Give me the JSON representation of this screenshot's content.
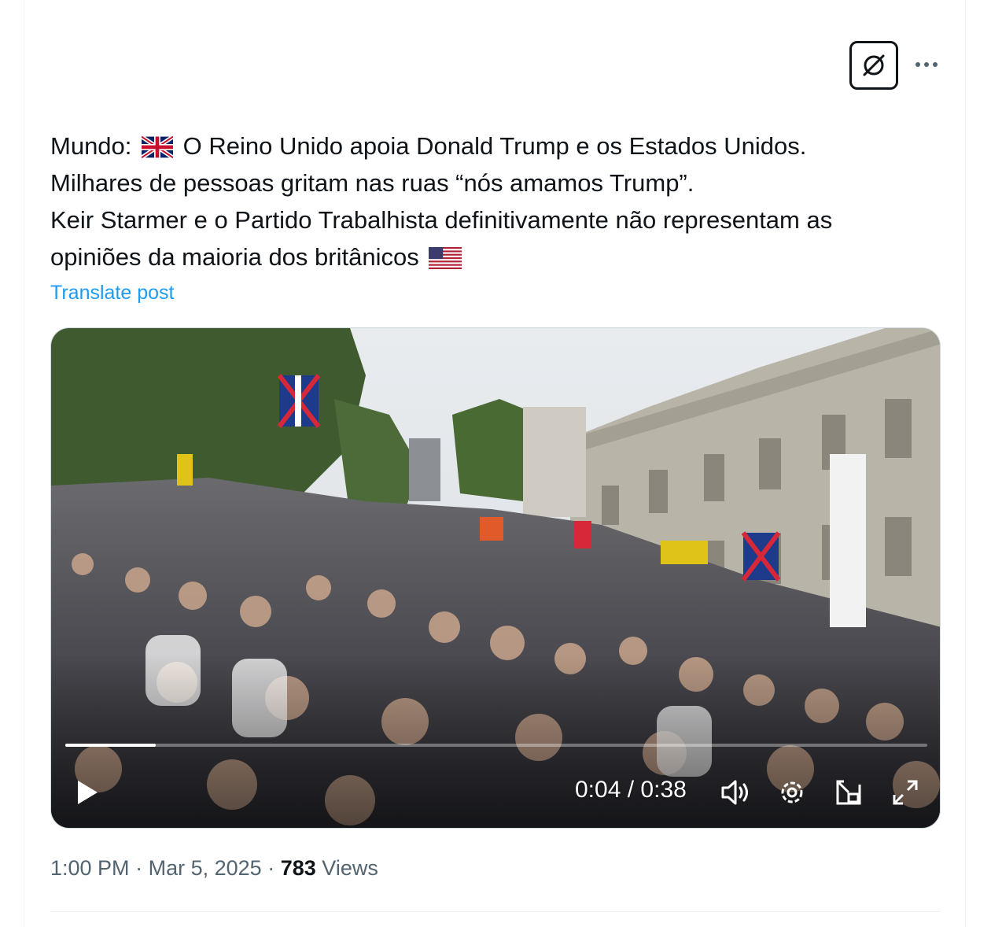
{
  "post": {
    "text_lines": [
      {
        "before": "Mundo:",
        "flag": "uk-flag",
        "after": "O Reino Unido apoia Donald Trump e os Estados Unidos."
      },
      {
        "text": "Milhares de pessoas gritam nas ruas “nós amamos Trump”."
      },
      {
        "text": "Keir Starmer e o Partido Trabalhista definitivamente não representam as"
      },
      {
        "text": "opiniões da maioria dos britânicos",
        "flag": "us-flag"
      }
    ],
    "translate_label": "Translate post"
  },
  "video": {
    "current_time": "0:04",
    "separator": "/",
    "duration": "0:38",
    "progress_fraction": 0.105,
    "state": "paused",
    "icons": [
      "play-icon",
      "volume-icon",
      "settings-icon",
      "pip-icon",
      "fullscreen-icon"
    ]
  },
  "meta": {
    "time": "1:00 PM",
    "dot": "·",
    "date": "Mar 5, 2025",
    "views_count": "783",
    "views_label": "Views"
  },
  "header": {
    "icons": [
      "grok-icon",
      "more-icon"
    ]
  },
  "colors": {
    "link": "#1d9bf0",
    "text": "#0f1419",
    "secondary": "#536471"
  }
}
